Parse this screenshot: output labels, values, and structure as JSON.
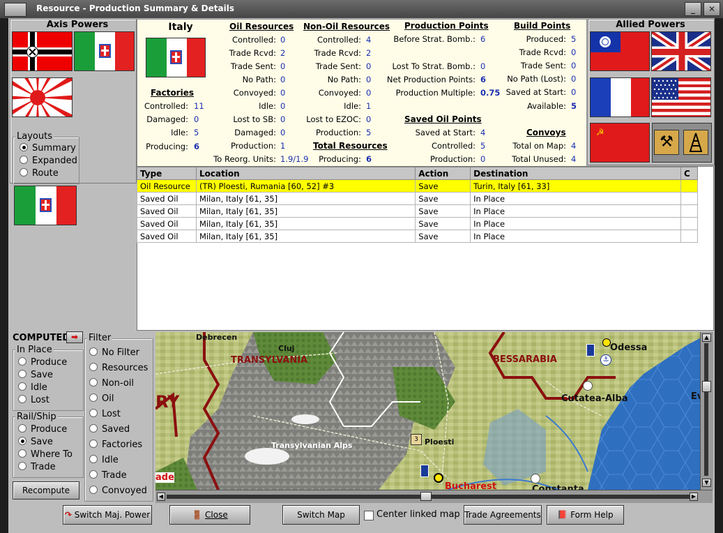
{
  "window": {
    "title": "Resource - Production Summary & Details"
  },
  "axis": {
    "header": "Axis Powers"
  },
  "allied": {
    "header": "Allied Powers"
  },
  "country": {
    "name": "Italy"
  },
  "factories": {
    "title": "Factories",
    "rows": [
      {
        "label": "Controlled:",
        "value": "11"
      },
      {
        "label": "Damaged:",
        "value": "0"
      },
      {
        "label": "Idle:",
        "value": "5"
      },
      {
        "label": "Producing:",
        "value": "6"
      }
    ]
  },
  "oil": {
    "title": "Oil Resources",
    "rows": [
      {
        "label": "Controlled:",
        "value": "0"
      },
      {
        "label": "Trade Rcvd:",
        "value": "2"
      },
      {
        "label": "Trade Sent:",
        "value": "0"
      },
      {
        "label": "No Path:",
        "value": "0"
      },
      {
        "label": "Convoyed:",
        "value": "0"
      },
      {
        "label": "Idle:",
        "value": "0"
      },
      {
        "label": "Lost to SB:",
        "value": "0"
      },
      {
        "label": "Damaged:",
        "value": "0"
      },
      {
        "label": "Production:",
        "value": "1"
      },
      {
        "label": "To Reorg. Units:",
        "value": "1.9/1.9"
      }
    ]
  },
  "nonoil": {
    "title": "Non-Oil Resources",
    "rows": [
      {
        "label": "Controlled:",
        "value": "4"
      },
      {
        "label": "Trade Rcvd:",
        "value": "2"
      },
      {
        "label": "Trade Sent:",
        "value": "0"
      },
      {
        "label": "No Path:",
        "value": "0"
      },
      {
        "label": "Convoyed:",
        "value": "0"
      },
      {
        "label": "Idle:",
        "value": "1"
      },
      {
        "label": "Lost to EZOC:",
        "value": "0"
      },
      {
        "label": "Production:",
        "value": "5"
      }
    ],
    "total_title": "Total Resources",
    "total_label": "Producing:",
    "total_value": "6"
  },
  "pp": {
    "title": "Production Points",
    "rows": [
      {
        "label": "Before Strat. Bomb.:",
        "value": "6"
      },
      {
        "label": "Lost To Strat. Bomb.:",
        "value": "0"
      },
      {
        "label": "Net Production Points:",
        "value": "6"
      },
      {
        "label": "Production Multiple:",
        "value": "0.75"
      }
    ]
  },
  "saved_oil": {
    "title": "Saved Oil Points",
    "rows": [
      {
        "label": "Saved at Start:",
        "value": "4"
      },
      {
        "label": "Controlled:",
        "value": "5"
      },
      {
        "label": "Production:",
        "value": "0"
      }
    ]
  },
  "bp": {
    "title": "Build Points",
    "rows": [
      {
        "label": "Produced:",
        "value": "5"
      },
      {
        "label": "Trade Rcvd:",
        "value": "0"
      },
      {
        "label": "Trade Sent:",
        "value": "0"
      },
      {
        "label": "No Path (Lost):",
        "value": "0"
      },
      {
        "label": "Saved at Start:",
        "value": "0"
      },
      {
        "label": "Available:",
        "value": "5"
      }
    ]
  },
  "convoys": {
    "title": "Convoys",
    "rows": [
      {
        "label": "Total on Map:",
        "value": "4"
      },
      {
        "label": "Total Unused:",
        "value": "4"
      }
    ]
  },
  "layouts": {
    "title": "Layouts",
    "options": [
      "Summary",
      "Expanded",
      "Route"
    ],
    "selected": "Summary"
  },
  "table": {
    "headers": [
      "Type",
      "Location",
      "Action",
      "Destination",
      "C"
    ],
    "rows": [
      [
        "Oil Resource",
        "(TR) Ploesti, Rumania [60, 52] #3",
        "Save",
        "Turin, Italy [61, 33]",
        ""
      ],
      [
        "Saved Oil",
        "Milan, Italy [61, 35]",
        "Save",
        "In Place",
        ""
      ],
      [
        "Saved Oil",
        "Milan, Italy [61, 35]",
        "Save",
        "In Place",
        ""
      ],
      [
        "Saved Oil",
        "Milan, Italy [61, 35]",
        "Save",
        "In Place",
        ""
      ],
      [
        "Saved Oil",
        "Milan, Italy [61, 35]",
        "Save",
        "In Place",
        ""
      ]
    ]
  },
  "computed": {
    "label": "COMPUTED"
  },
  "inplace": {
    "title": "In Place",
    "options": [
      "Produce",
      "Save",
      "Idle",
      "Lost"
    ]
  },
  "railship": {
    "title": "Rail/Ship",
    "options": [
      "Produce",
      "Save",
      "Where To",
      "Trade"
    ],
    "selected": "Save"
  },
  "filter": {
    "title": "Filter",
    "options": [
      "No Filter",
      "Resources",
      "Non-oil",
      "Oil",
      "Lost",
      "Saved",
      "Factories",
      "Idle",
      "Trade",
      "Convoyed"
    ]
  },
  "buttons": {
    "recompute": "Recompute",
    "switch_power": "Switch Maj. Power",
    "close": "Close",
    "switch_map": "Switch Map",
    "center_linked": "Center linked map",
    "trade": "Trade Agreements",
    "help": "Form Help"
  },
  "map": {
    "labels": [
      "Debrecen",
      "Cluj",
      "TRANSYLVANIA",
      "BESSARABIA",
      "Odessa",
      "Cutatea-Alba",
      "Ev",
      "Transylvanian Alps",
      "Ploesti",
      "Bucharest",
      "Constanta",
      "ade",
      "RY"
    ],
    "ploesti_badge": "3"
  },
  "colors": {
    "highlight": "#ffff00",
    "value_blue": "#1a2fb0",
    "panel": "#bdbdbd",
    "title_bar": "#4f4f4f"
  }
}
